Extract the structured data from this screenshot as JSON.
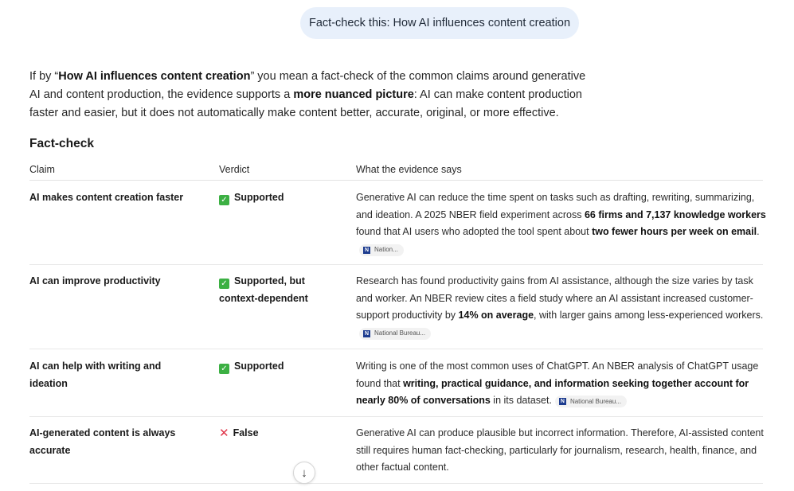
{
  "user_message": "Fact-check this: How AI influences content creation",
  "intro": {
    "p1": "If by “",
    "b1": "How AI influences content creation",
    "p2": "” you mean a fact-check of the common claims around generative AI and content production, the evidence supports a ",
    "b2": "more nuanced picture",
    "p3": ": AI can make content production faster and easier, but it does not automatically make content better, accurate, original, or more effective."
  },
  "section_title": "Fact-check",
  "table": {
    "headers": {
      "claim": "Claim",
      "verdict": "Verdict",
      "evidence": "What the evidence says"
    },
    "rows": [
      {
        "claim": "AI makes content creation faster",
        "verdict": "Supported",
        "verdict_icon": "check-icon",
        "evidence": {
          "t1": "Generative AI can reduce the time spent on tasks such as drafting, rewriting, summarizing, and ideation. A 2025 NBER field experiment across ",
          "b1": "66 firms and 7,137 knowledge workers",
          "t2": " found that AI users who adopted the tool spent about ",
          "b2": "two fewer hours per week on email",
          "t3": "."
        },
        "citation": "Nation..."
      },
      {
        "claim": "AI can improve productivity",
        "verdict": "Supported, but context-dependent",
        "verdict_icon": "check-icon",
        "evidence": {
          "t1": "Research has found productivity gains from AI assistance, although the size varies by task and worker. An NBER review cites a field study where an AI assistant increased customer-support productivity by ",
          "b1": "14% on average",
          "t2": ", with larger gains among less-experienced workers."
        },
        "citation": "National Bureau..."
      },
      {
        "claim": "AI can help with writing and ideation",
        "verdict": "Supported",
        "verdict_icon": "check-icon",
        "evidence": {
          "t1": "Writing is one of the most common uses of ChatGPT. An NBER analysis of ChatGPT usage found that ",
          "b1": "writing, practical guidance, and information seeking together account for nearly 80% of conversations",
          "t2": " in its dataset."
        },
        "citation": "National Bureau..."
      },
      {
        "claim": "AI-generated content is always accurate",
        "verdict": "False",
        "verdict_icon": "cross-icon",
        "evidence": {
          "t1": "Generative AI can produce plausible but incorrect information. Therefore, AI-assisted content still requires human fact-checking, particularly for journalism, research, health, finance, and other factual content."
        }
      }
    ]
  },
  "colors": {
    "bubble_bg": "#e8f0fb",
    "check_green": "#3cb043",
    "cross_red": "#e0364a",
    "citation_logo": "#1d3c8f"
  },
  "scroll_button_icon": "arrow-down-icon"
}
